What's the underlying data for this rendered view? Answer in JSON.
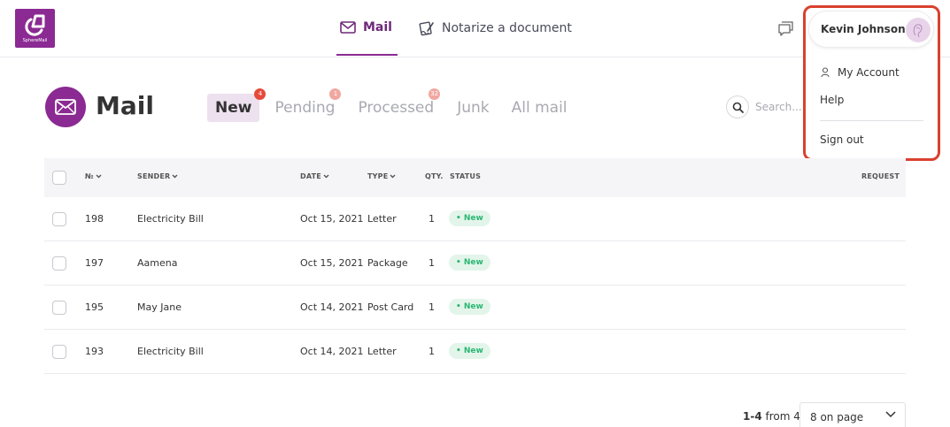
{
  "header": {
    "logo_text": "SphereMail",
    "nav": [
      {
        "label": "Mail",
        "icon": "envelope-icon",
        "active": true
      },
      {
        "label": "Notarize a document",
        "icon": "signature-icon",
        "active": false
      }
    ]
  },
  "user_menu": {
    "name": "Kevin Johnson",
    "items": {
      "account": "My Account",
      "help": "Help",
      "signout": "Sign out"
    }
  },
  "page": {
    "title": "Mail",
    "tabs": [
      {
        "label": "New",
        "count": "4",
        "active": true
      },
      {
        "label": "Pending",
        "count": "1",
        "active": false
      },
      {
        "label": "Processed",
        "count": "32",
        "active": false
      },
      {
        "label": "Junk",
        "count": null,
        "active": false
      },
      {
        "label": "All mail",
        "count": null,
        "active": false
      }
    ],
    "search_placeholder": "Search..."
  },
  "table": {
    "columns": {
      "number": "№",
      "sender": "SENDER",
      "date": "DATE",
      "type": "TYPE",
      "qty": "QTY.",
      "status": "STATUS",
      "request": "REQUEST"
    },
    "rows": [
      {
        "number": "198",
        "sender": "Electricity Bill",
        "date": "Oct 15, 2021",
        "type": "Letter",
        "qty": "1",
        "status": "• New"
      },
      {
        "number": "197",
        "sender": "Aamena",
        "date": "Oct 15, 2021",
        "type": "Package",
        "qty": "1",
        "status": "• New"
      },
      {
        "number": "195",
        "sender": "May Jane",
        "date": "Oct 14, 2021",
        "type": "Post Card",
        "qty": "1",
        "status": "• New"
      },
      {
        "number": "193",
        "sender": "Electricity Bill",
        "date": "Oct 14, 2021",
        "type": "Letter",
        "qty": "1",
        "status": "• New"
      }
    ]
  },
  "pagination": {
    "range": "1-4",
    "from_text": "from 4",
    "per_page": "8 on page"
  },
  "colors": {
    "brand": "#8b2a93",
    "active_tab_bg": "#ede0ef",
    "badge": "#e64a3b",
    "status_new": "#2bb673",
    "highlight_border": "#d9412f"
  }
}
